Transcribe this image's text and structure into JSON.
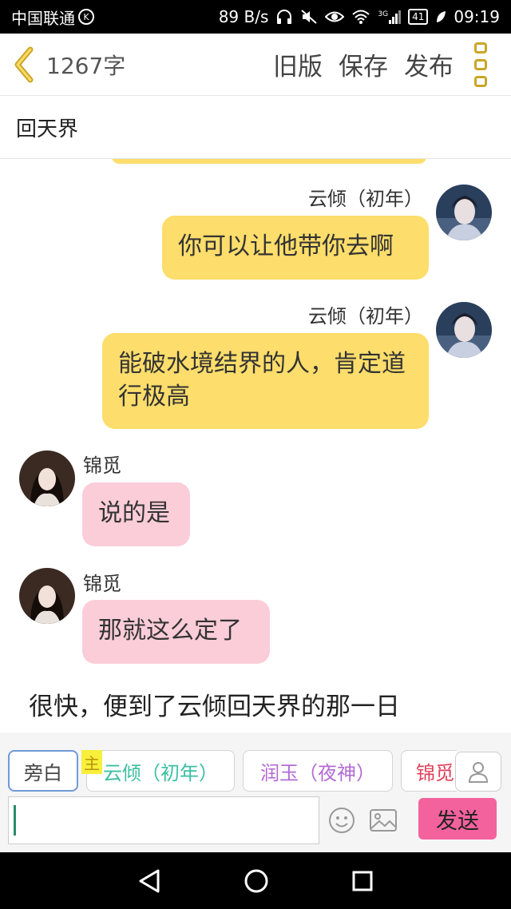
{
  "status": {
    "carrier": "中国联通",
    "k": "K",
    "speed": "89 B/s",
    "network": "3G",
    "battery": "41",
    "time": "09:19"
  },
  "topbar": {
    "word_count": "1267字",
    "actions": [
      "旧版",
      "保存",
      "发布"
    ]
  },
  "doc_title": "回天界",
  "messages": [
    {
      "side": "right",
      "name": "云倾（初年）",
      "text": "你可以让他带你去啊",
      "color": "#fddd6b"
    },
    {
      "side": "right",
      "name": "云倾（初年）",
      "text": "能破水境结界的人，肯定道行极高",
      "color": "#fddd6b"
    },
    {
      "side": "left",
      "name": "锦觅",
      "text": "说的是",
      "color": "#fbcdd8"
    },
    {
      "side": "left",
      "name": "锦觅",
      "text": "那就这么定了",
      "color": "#fbcdd8"
    }
  ],
  "narration": "很快，便到了云倾回天界的那一日",
  "characters": [
    {
      "label": "旁白",
      "color": "#444444"
    },
    {
      "label": "云倾（初年）",
      "color": "#3bbfa3"
    },
    {
      "label": "润玉（夜神）",
      "color": "#b36bd4"
    },
    {
      "label": "锦觅",
      "color": "#e0405a"
    }
  ],
  "main_tag": "主",
  "input": {
    "value": "",
    "placeholder": ""
  },
  "send_label": "发送",
  "icons": {
    "back": "chevron-left-icon",
    "menu": "more-vertical-icon",
    "emoji": "emoji-icon",
    "image": "image-icon",
    "user": "user-icon"
  }
}
